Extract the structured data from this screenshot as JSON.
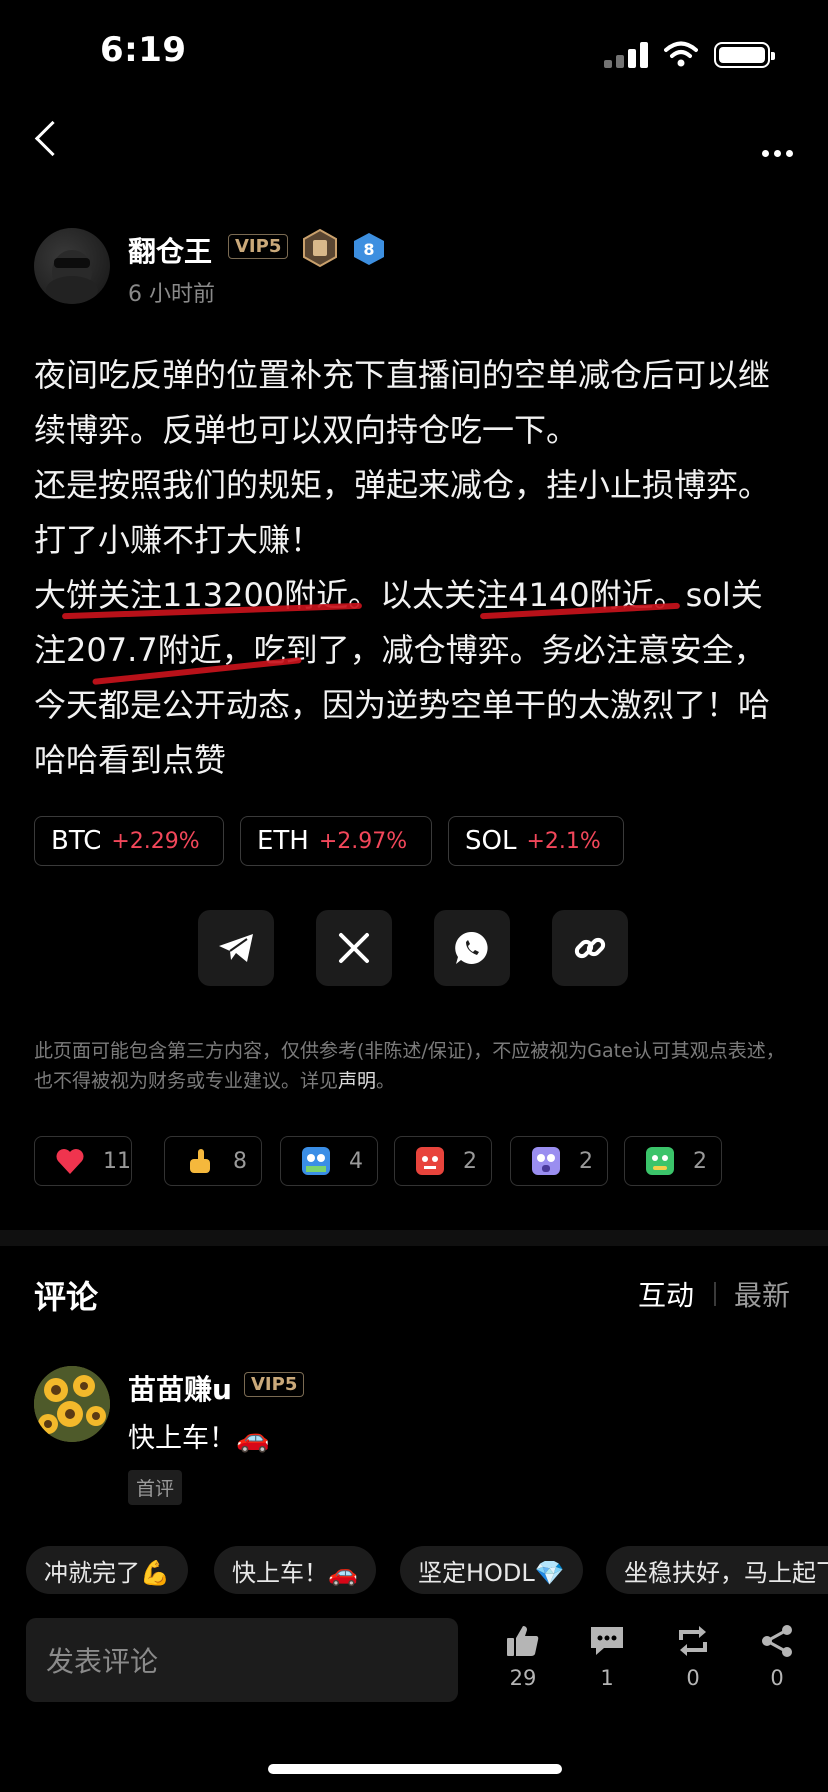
{
  "status": {
    "time": "6:19"
  },
  "author": {
    "name": "翻仓王",
    "vip": "VIP5",
    "level": "8",
    "time": "6 小时前"
  },
  "post": {
    "paragraphs": [
      "夜间吃反弹的位置补充下直播间的空单减仓后可以继续博弈。反弹也可以双向持仓吃一下。",
      "还是按照我们的规矩，弹起来减仓，挂小止损博弈。打了小赚不打大赚！",
      "大饼关注113200附近。以太关注4140附近。sol关注207.7附近，吃到了，减仓博弈。务必注意安全，今天都是公开动态，因为逆势空单干的太激烈了！哈哈哈看到点赞"
    ]
  },
  "tickers": [
    {
      "symbol": "BTC",
      "change": "+2.29%"
    },
    {
      "symbol": "ETH",
      "change": "+2.97%"
    },
    {
      "symbol": "SOL",
      "change": "+2.1%"
    }
  ],
  "share_icons": [
    "telegram-icon",
    "x-icon",
    "whatsapp-icon",
    "link-icon"
  ],
  "disclaimer": {
    "text": "此页面可能包含第三方内容，仅供参考(非陈述/保证)，不应被视为Gate认可其观点表述，也不得被视为财务或专业建议。详见",
    "link": "声明",
    "end": "。"
  },
  "reactions": [
    {
      "icon": "heart-icon",
      "count": "11"
    },
    {
      "icon": "thumbs-up-icon",
      "count": "8"
    },
    {
      "icon": "hodl-emoji-icon",
      "count": "4"
    },
    {
      "icon": "angry-emoji-icon",
      "count": "2"
    },
    {
      "icon": "shocked-emoji-icon",
      "count": "2"
    },
    {
      "icon": "sick-emoji-icon",
      "count": "2"
    }
  ],
  "comments_section": {
    "title": "评论",
    "tab_active": "互动",
    "tab_other": "最新"
  },
  "comment": {
    "name": "苗苗赚u",
    "vip": "VIP5",
    "text": "快上车！🚗",
    "tag": "首评"
  },
  "quick_replies": [
    "冲就完了💪",
    "快上车！🚗",
    "坚定HODL💎",
    "坐稳扶好，马上起飞"
  ],
  "bottom_bar": {
    "placeholder": "发表评论",
    "like_count": "29",
    "comment_count": "1",
    "repost_count": "0",
    "share_count": "0"
  },
  "colors": {
    "up": "#f2475a",
    "highlight": "#c8121b",
    "vip": "#caa97a"
  }
}
